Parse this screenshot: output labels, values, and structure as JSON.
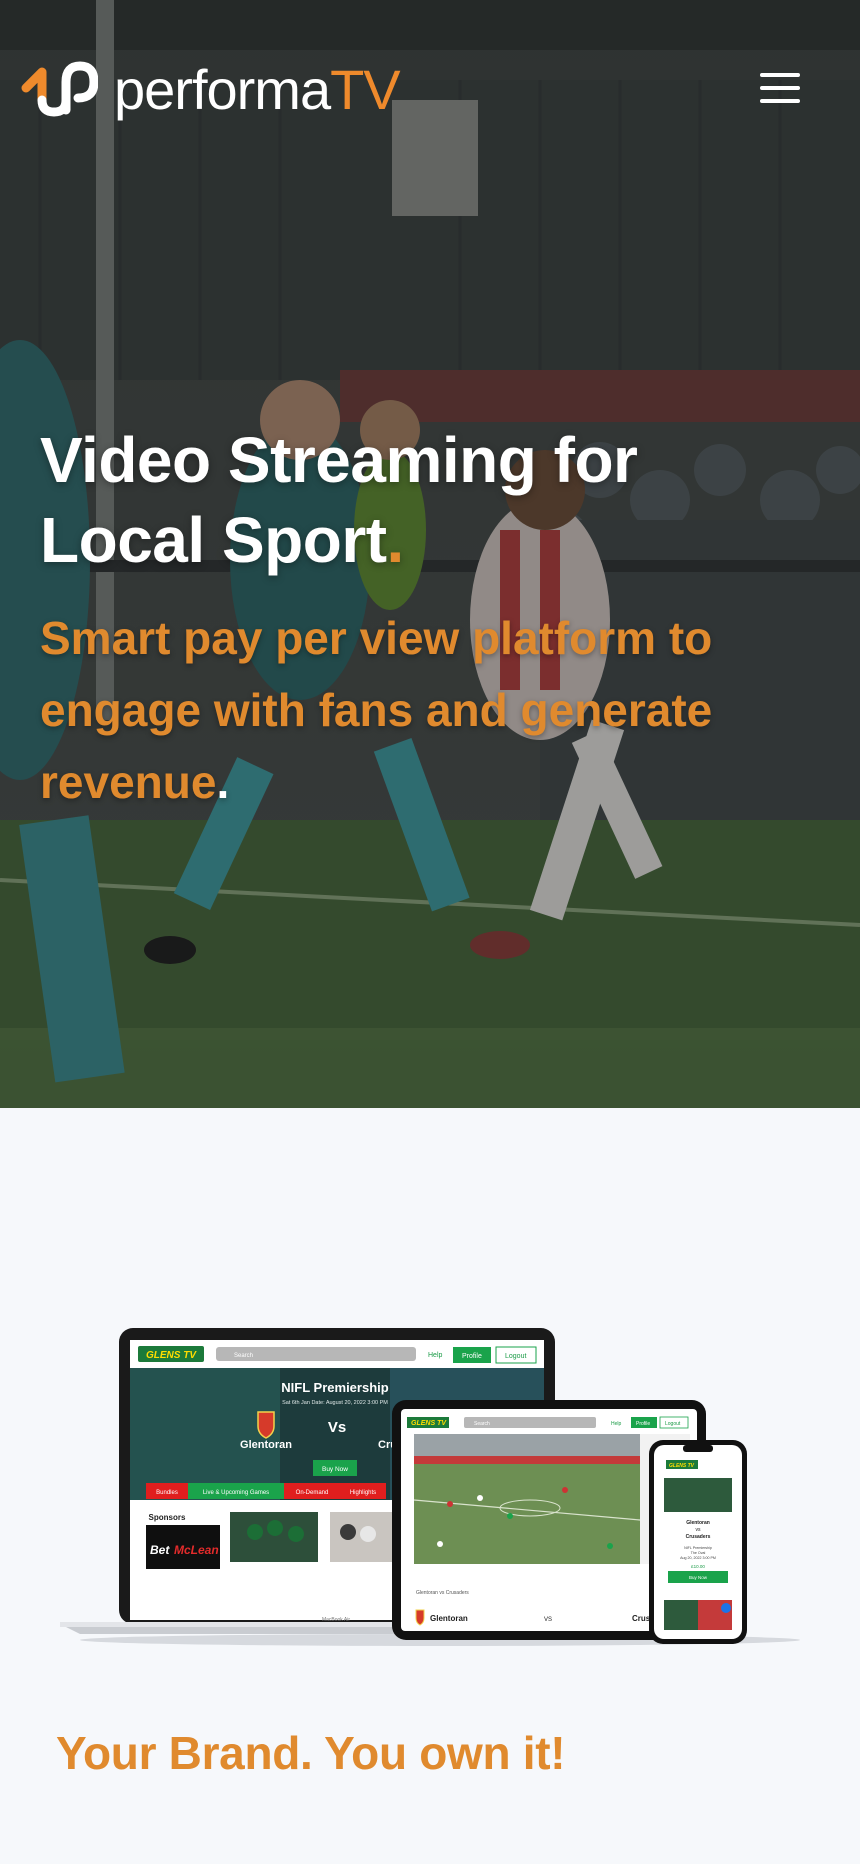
{
  "brand": {
    "name_main": "performa",
    "name_accent": "TV",
    "accent_color": "#ef8a2c"
  },
  "nav": {
    "menu_icon": "hamburger-menu-icon"
  },
  "hero": {
    "title_line1": "Video Streaming for",
    "title_line2": "Local Sport",
    "title_dot": ".",
    "subtitle": "Smart pay per view platform to engage with fans and generate revenue",
    "subtitle_dot": "."
  },
  "mockup": {
    "laptop": {
      "logo": "GLENS TV",
      "search_placeholder": "Search",
      "help": "Help",
      "profile": "Profile",
      "logout": "Logout",
      "league": "NIFL Premiership",
      "match_line": "Sat 6th Jan Date: August 20, 2022 3:00 PM",
      "home_team": "Glentoran",
      "vs": "Vs",
      "away_team": "Crusaders",
      "buy_now": "Buy Now",
      "tabs": [
        "Bundles",
        "Live & Upcoming Games",
        "On-Demand",
        "Highlights"
      ],
      "sponsors": "Sponsors",
      "sponsor_name_a": "Bet",
      "sponsor_name_b": "McLean",
      "model_label": "MacBook Air"
    },
    "tablet": {
      "logo": "GLENS TV",
      "search_placeholder": "Search",
      "help": "Help",
      "profile": "Profile",
      "logout": "Logout",
      "caption": "Glentoran vs Crusaders",
      "home_team": "Glentoran",
      "vs": "VS",
      "away_team": "Crusaders"
    },
    "phone": {
      "logo": "GLENS TV",
      "home_team": "Glentoran",
      "vs": "vs",
      "away_team": "Crusaders",
      "league": "NIFL Premiership",
      "venue": "The Oval",
      "date": "Aug 20, 2022 3:00 PM",
      "price": "£10.00",
      "buy_now": "Buy Now"
    }
  },
  "section": {
    "heading": "Your Brand. You own it!"
  }
}
